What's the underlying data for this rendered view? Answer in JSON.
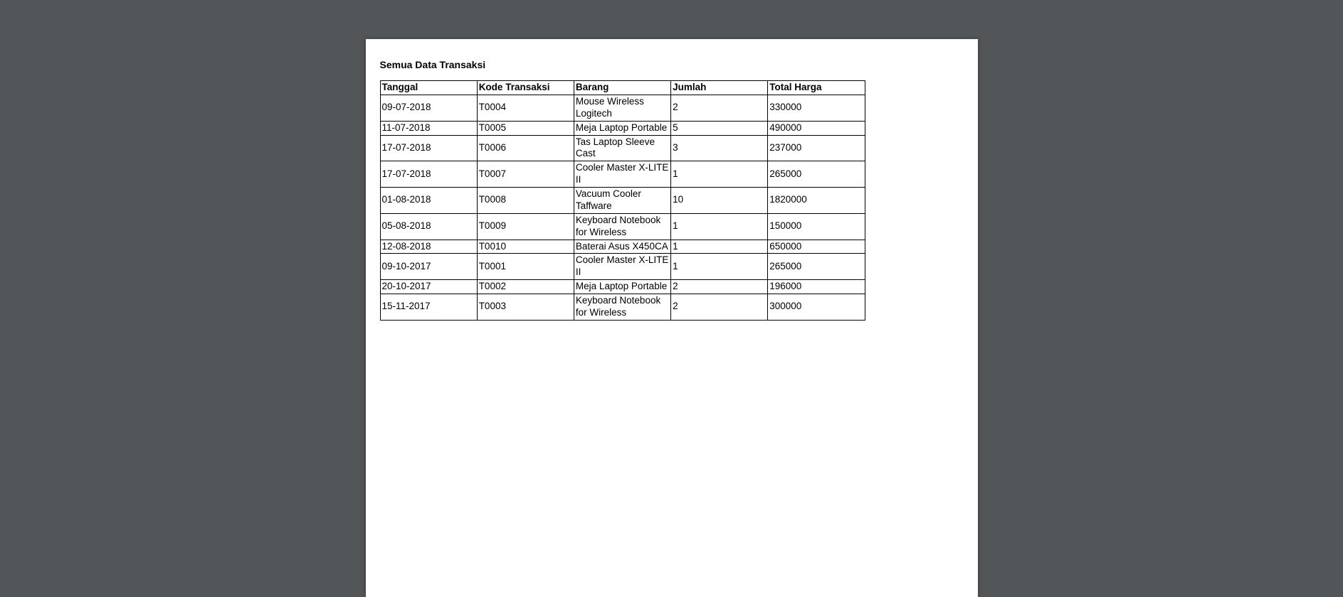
{
  "title": "Semua Data Transaksi",
  "headers": {
    "tanggal": "Tanggal",
    "kode": "Kode Transaksi",
    "barang": "Barang",
    "jumlah": "Jumlah",
    "total": "Total Harga"
  },
  "rows": [
    {
      "tanggal": "09-07-2018",
      "kode": "T0004",
      "barang": "Mouse Wireless Logitech",
      "jumlah": "2",
      "total": "330000"
    },
    {
      "tanggal": "11-07-2018",
      "kode": "T0005",
      "barang": "Meja Laptop Portable",
      "jumlah": "5",
      "total": "490000"
    },
    {
      "tanggal": "17-07-2018",
      "kode": "T0006",
      "barang": "Tas Laptop Sleeve Cast",
      "jumlah": "3",
      "total": "237000"
    },
    {
      "tanggal": "17-07-2018",
      "kode": "T0007",
      "barang": "Cooler Master X-LITE II",
      "jumlah": "1",
      "total": "265000"
    },
    {
      "tanggal": "01-08-2018",
      "kode": "T0008",
      "barang": "Vacuum Cooler Taffware",
      "jumlah": "10",
      "total": "1820000"
    },
    {
      "tanggal": "05-08-2018",
      "kode": "T0009",
      "barang": "Keyboard Notebook for Wireless",
      "jumlah": "1",
      "total": "150000"
    },
    {
      "tanggal": "12-08-2018",
      "kode": "T0010",
      "barang": "Baterai Asus X450CA",
      "jumlah": "1",
      "total": "650000"
    },
    {
      "tanggal": "09-10-2017",
      "kode": "T0001",
      "barang": "Cooler Master X-LITE II",
      "jumlah": "1",
      "total": "265000"
    },
    {
      "tanggal": "20-10-2017",
      "kode": "T0002",
      "barang": "Meja Laptop Portable",
      "jumlah": "2",
      "total": "196000"
    },
    {
      "tanggal": "15-11-2017",
      "kode": "T0003",
      "barang": "Keyboard Notebook for Wireless",
      "jumlah": "2",
      "total": "300000"
    }
  ]
}
